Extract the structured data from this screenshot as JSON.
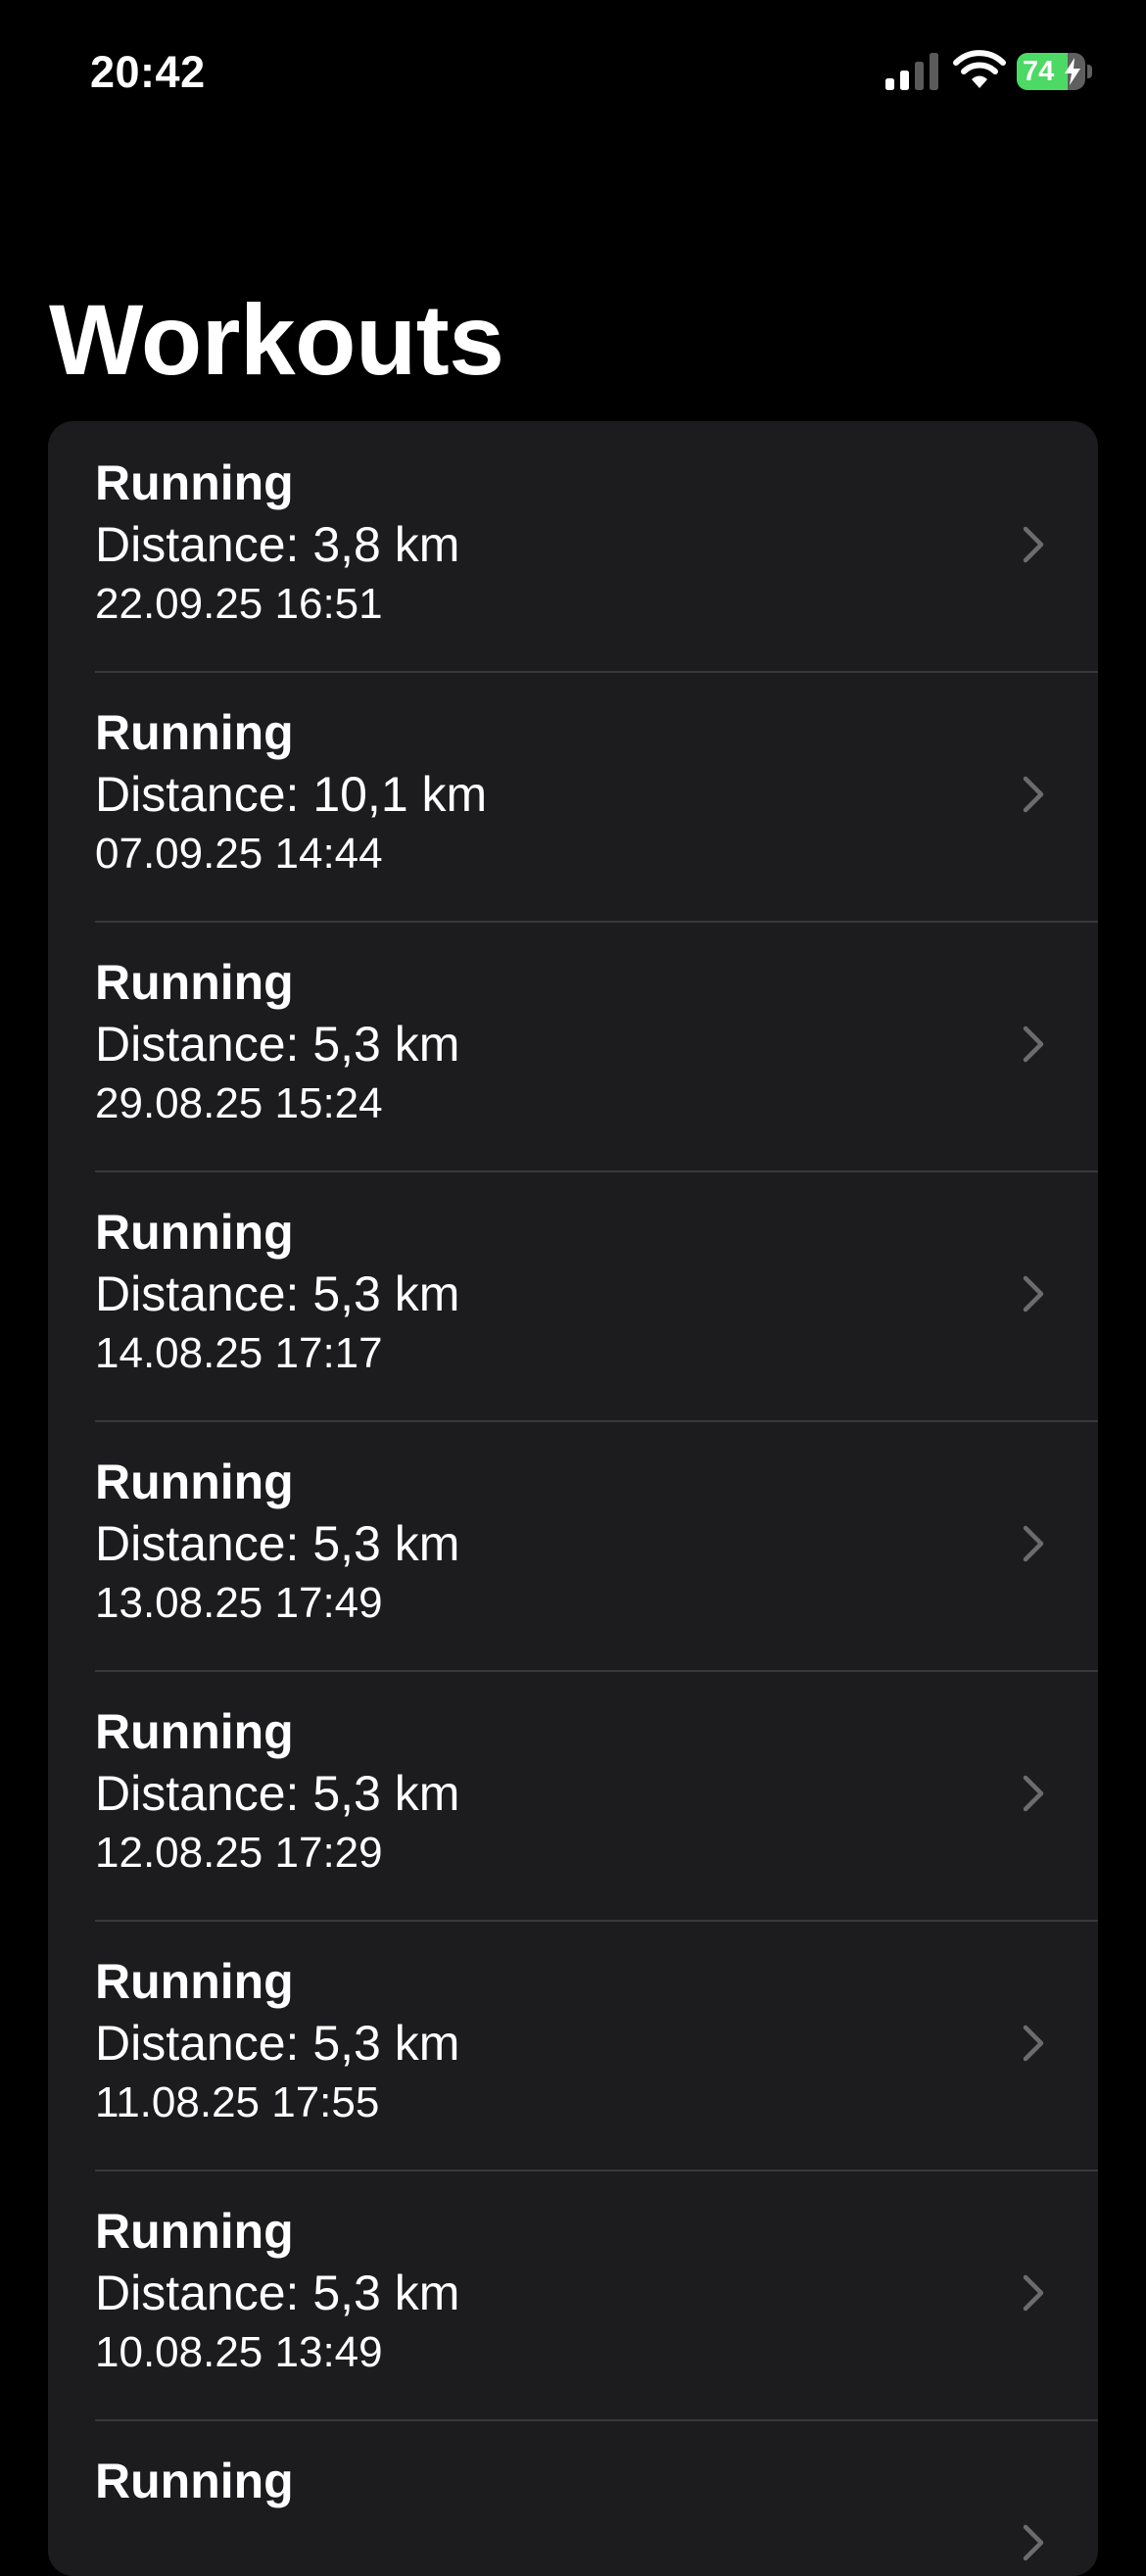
{
  "status_bar": {
    "time": "20:42",
    "battery_level": "74",
    "battery_fraction": 0.74,
    "battery_charging": true,
    "icons": [
      "cellular-signal-icon",
      "wifi-icon",
      "battery-icon",
      "charging-bolt-icon"
    ]
  },
  "page": {
    "title": "Workouts"
  },
  "workouts": [
    {
      "type": "Running",
      "distance": "Distance: 3,8 km",
      "date": "22.09.25 16:51"
    },
    {
      "type": "Running",
      "distance": "Distance: 10,1 km",
      "date": "07.09.25 14:44"
    },
    {
      "type": "Running",
      "distance": "Distance: 5,3 km",
      "date": "29.08.25 15:24"
    },
    {
      "type": "Running",
      "distance": "Distance: 5,3 km",
      "date": "14.08.25 17:17"
    },
    {
      "type": "Running",
      "distance": "Distance: 5,3 km",
      "date": "13.08.25 17:49"
    },
    {
      "type": "Running",
      "distance": "Distance: 5,3 km",
      "date": "12.08.25 17:29"
    },
    {
      "type": "Running",
      "distance": "Distance: 5,3 km",
      "date": "11.08.25 17:55"
    },
    {
      "type": "Running",
      "distance": "Distance: 5,3 km",
      "date": "10.08.25 13:49"
    },
    {
      "type": "Running"
    }
  ],
  "colors": {
    "background": "#000000",
    "list_background": "#1c1c1e",
    "separator": "#38383a",
    "chevron": "#6b6b70",
    "battery_green": "#4cd964"
  }
}
